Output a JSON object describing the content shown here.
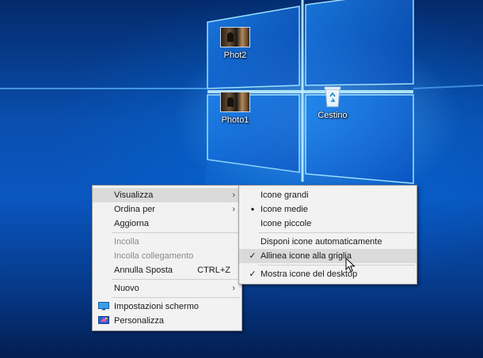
{
  "desktop": {
    "icons": [
      {
        "label": "Phot2",
        "icon": "photo-thumbnail-icon"
      },
      {
        "label": "Photo1",
        "icon": "photo-thumbnail-icon"
      },
      {
        "label": "Cestino",
        "icon": "recycle-bin-icon"
      }
    ]
  },
  "context_menu": {
    "items": [
      {
        "label": "Visualizza",
        "submenu": true,
        "highlighted": true
      },
      {
        "label": "Ordina per",
        "submenu": true
      },
      {
        "label": "Aggiorna"
      },
      {
        "label": "Incolla",
        "disabled": true
      },
      {
        "label": "Incolla collegamento",
        "disabled": true
      },
      {
        "label": "Annulla Sposta",
        "shortcut": "CTRL+Z"
      },
      {
        "label": "Nuovo",
        "submenu": true
      },
      {
        "label": "Impostazioni schermo",
        "icon": "display-settings-icon"
      },
      {
        "label": "Personalizza",
        "icon": "personalize-icon"
      }
    ]
  },
  "submenu_visualizza": {
    "items": [
      {
        "label": "Icone grandi"
      },
      {
        "label": "Icone medie",
        "mark": "bullet"
      },
      {
        "label": "Icone piccole"
      },
      {
        "label": "Disponi icone automaticamente"
      },
      {
        "label": "Allinea icone alla griglia",
        "mark": "check",
        "highlighted": true
      },
      {
        "label": "Mostra icone del desktop",
        "mark": "check"
      }
    ]
  },
  "glyphs": {
    "arrow": "›",
    "bullet": "●",
    "check": "✓"
  },
  "colors": {
    "menu_bg": "#f2f2f2",
    "menu_highlight": "#dadada",
    "desktop_blue": "#0a4fb0"
  }
}
